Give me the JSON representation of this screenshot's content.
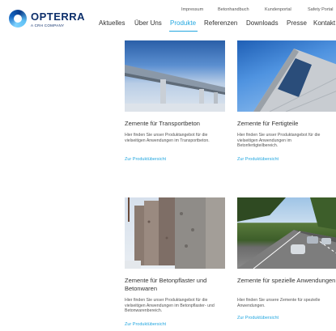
{
  "brand": {
    "name": "OPTERRA",
    "subtitle": "A CRH COMPANY"
  },
  "meta_nav": [
    "Impressum",
    "Betonhandbuch",
    "Kundenportal",
    "Safety Portal"
  ],
  "main_nav": {
    "items": [
      "Aktuelles",
      "Über Uns",
      "Produkte",
      "Referenzen",
      "Downloads",
      "Presse",
      "Kontakt"
    ],
    "active": "Produkte"
  },
  "cards": [
    {
      "title": "Zemente für Transportbeton",
      "description": "Hier finden Sie unser Produktangebot für die vielseitigen Anwendungen im Transportbeton.",
      "link": "Zur Produktübersicht"
    },
    {
      "title": "Zemente für Fertigteile",
      "description": "Hier finden Sie unser Produktangebot für die vielseitigen Anwendungen im Betonfertigteilbereich.",
      "link": "Zur Produktübersicht"
    },
    {
      "title": "Zemente für Betonpflaster und Betonwaren",
      "description": "Hier finden Sie unser Produktangebot für die vielseitigen Anwendungen im Betonpflaster- und Betonwarenbereich.",
      "link": "Zur Produktübersicht"
    },
    {
      "title": "Zemente für spezielle Anwendungen",
      "description": "Hier finden Sie unsere Zemente für spezielle Anwendungen.",
      "link": "Zur Produktübersicht"
    }
  ],
  "colors": {
    "accent": "#23a7e0",
    "brand": "#0d2f6b"
  }
}
